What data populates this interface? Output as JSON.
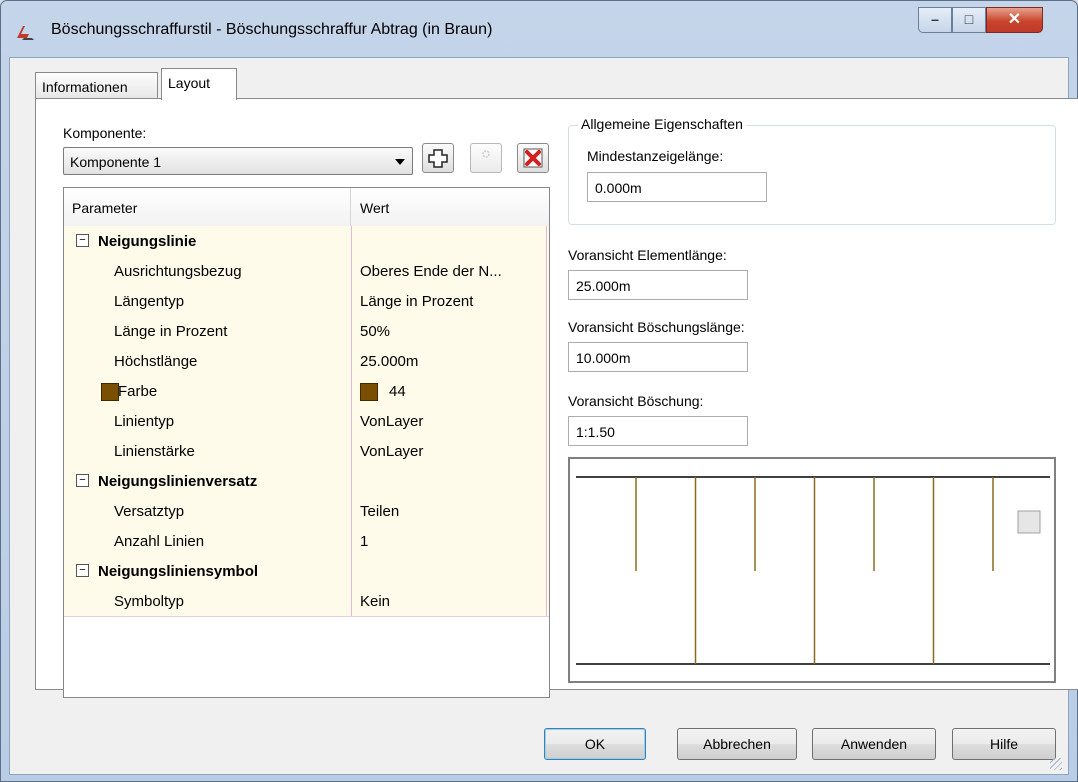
{
  "window": {
    "title": "Böschungsschraffurstil - Böschungsschraffur Abtrag (in Braun)"
  },
  "tabs": [
    {
      "label": "Informationen",
      "active": false
    },
    {
      "label": "Layout",
      "active": true
    }
  ],
  "component": {
    "label": "Komponente:",
    "selected": "Komponente 1"
  },
  "grid": {
    "headers": {
      "parameter": "Parameter",
      "value": "Wert"
    },
    "rows": [
      {
        "kind": "category",
        "name": "Neigungslinie",
        "value": ""
      },
      {
        "kind": "prop",
        "name": "Ausrichtungsbezug",
        "value": "Oberes Ende der N..."
      },
      {
        "kind": "prop",
        "name": "Längentyp",
        "value": "Länge in Prozent"
      },
      {
        "kind": "prop",
        "name": "Länge in Prozent",
        "value": "50%"
      },
      {
        "kind": "prop",
        "name": "Höchstlänge",
        "value": "25.000m"
      },
      {
        "kind": "color",
        "name": "Farbe",
        "value": "44",
        "color": "#7a4f00"
      },
      {
        "kind": "prop",
        "name": "Linientyp",
        "value": "VonLayer"
      },
      {
        "kind": "prop",
        "name": "Linienstärke",
        "value": "VonLayer"
      },
      {
        "kind": "category",
        "name": "Neigungslinienversatz",
        "value": ""
      },
      {
        "kind": "prop",
        "name": "Versatztyp",
        "value": "Teilen"
      },
      {
        "kind": "prop",
        "name": "Anzahl Linien",
        "value": "1"
      },
      {
        "kind": "category",
        "name": "Neigungsliniensymbol",
        "value": ""
      },
      {
        "kind": "prop",
        "name": "Symboltyp",
        "value": "Kein"
      }
    ]
  },
  "general": {
    "group_title": "Allgemeine Eigenschaften",
    "min_display_label": "Mindestanzeigelänge:",
    "min_display_value": "0.000m"
  },
  "preview": {
    "element_length_label": "Voransicht Elementlänge:",
    "element_length_value": "25.000m",
    "slope_length_label": "Voransicht Böschungslänge:",
    "slope_length_value": "10.000m",
    "slope_label": "Voransicht Böschung:",
    "slope_value": "1:1.50",
    "line_color": "#8b6b1e"
  },
  "buttons": {
    "ok": "OK",
    "cancel": "Abbrechen",
    "apply": "Anwenden",
    "help": "Hilfe"
  },
  "icons": {
    "add": "add-component-icon",
    "copy": "copy-component-icon",
    "delete": "delete-component-icon"
  }
}
